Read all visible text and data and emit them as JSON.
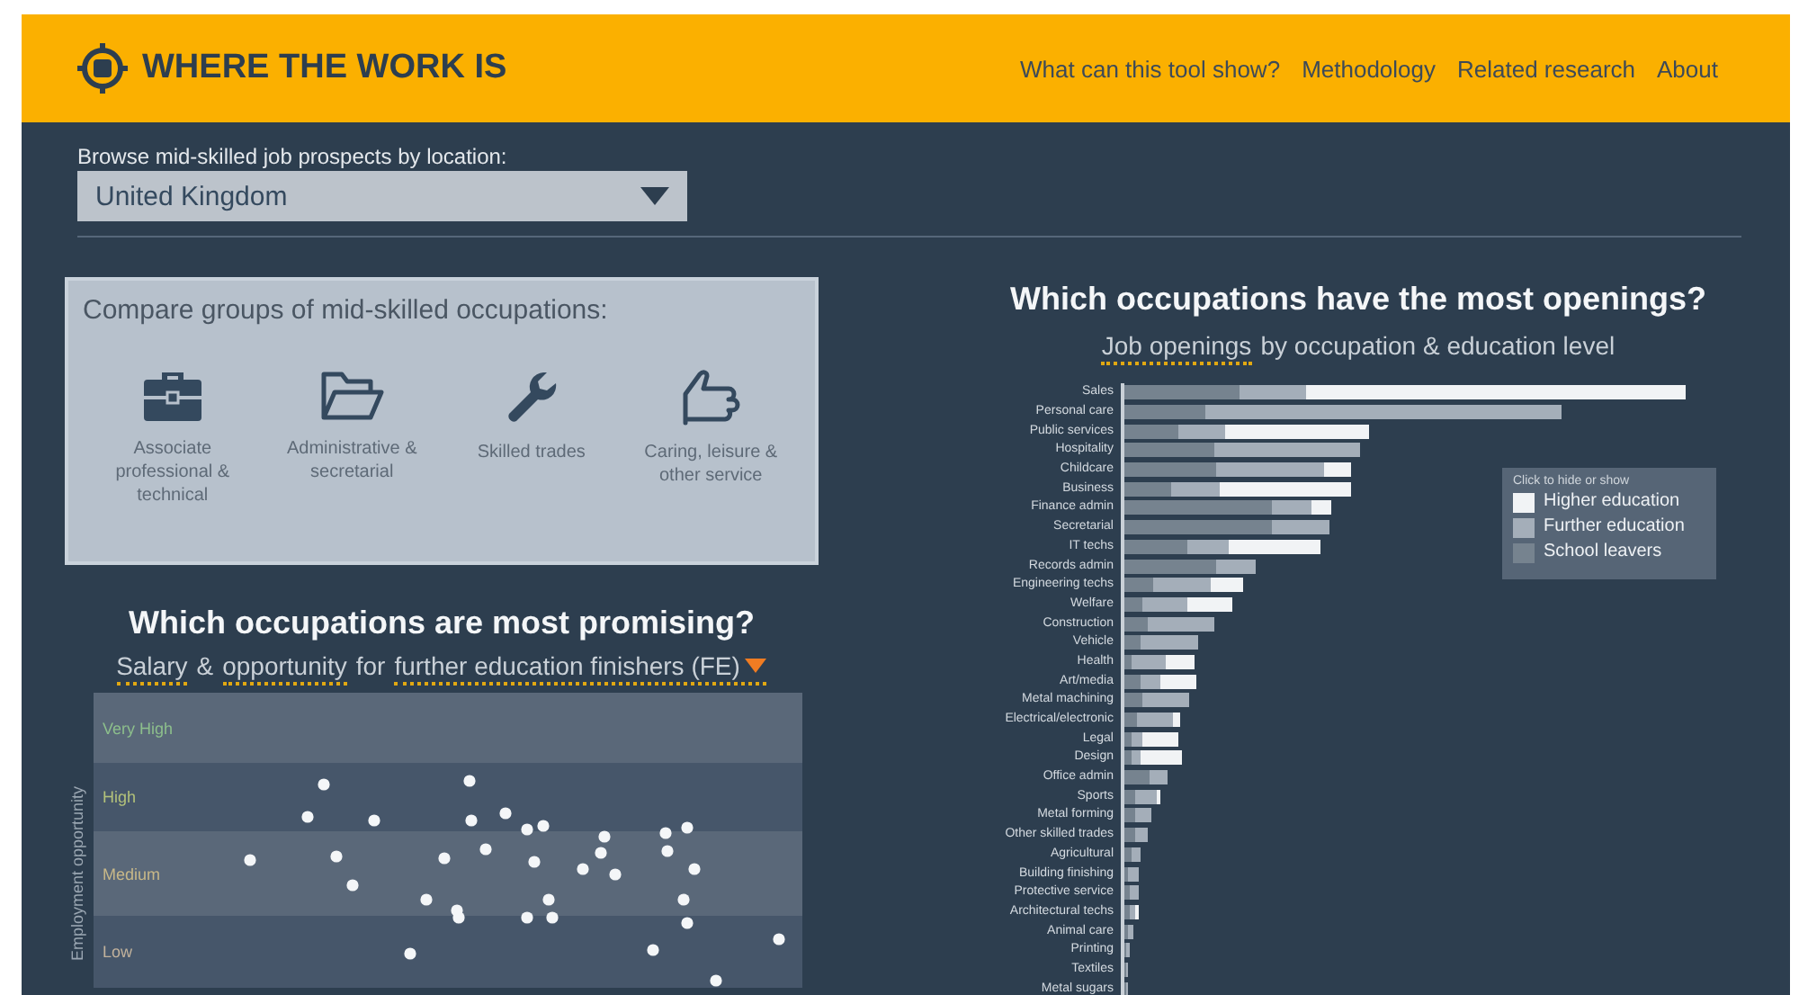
{
  "header": {
    "title": "WHERE THE WORK IS",
    "nav": [
      "What can this tool show?",
      "Methodology",
      "Related research",
      "About"
    ]
  },
  "location": {
    "label": "Browse mid-skilled job prospects by location:",
    "value": "United Kingdom"
  },
  "compare": {
    "title": "Compare groups of mid-skilled occupations:",
    "groups": [
      "Associate professional & technical",
      "Administrative & secretarial",
      "Skilled trades",
      "Caring, leisure & other service"
    ]
  },
  "promising": {
    "title": "Which occupations are most promising?",
    "subtitle": [
      {
        "text": "Salary",
        "selectable": true
      },
      {
        "text": "&",
        "selectable": false
      },
      {
        "text": "opportunity",
        "selectable": true
      },
      {
        "text": "for",
        "selectable": false
      },
      {
        "text": "further education finishers (FE)",
        "selectable": true
      }
    ],
    "y_label": "Employment opportunity",
    "bands": [
      {
        "label": "Very High",
        "color": "#8dbf8c"
      },
      {
        "label": "High",
        "color": "#b3c27a"
      },
      {
        "label": "Medium",
        "color": "#c8b888"
      },
      {
        "label": "Low",
        "color": "#c2b29c"
      }
    ]
  },
  "openings": {
    "title": "Which occupations have the most openings?",
    "subtitle": [
      {
        "text": "Job openings",
        "selectable": true
      },
      {
        "text": "by occupation & education level",
        "selectable": false
      }
    ],
    "categories": [
      "Sales",
      "Personal care",
      "Public services",
      "Hospitality",
      "Childcare",
      "Business",
      "Finance admin",
      "Secretarial",
      "IT techs",
      "Records admin",
      "Engineering techs",
      "Welfare",
      "Construction",
      "Vehicle",
      "Health",
      "Art/media",
      "Metal machining",
      "Electrical/electronic",
      "Legal",
      "Design",
      "Office admin",
      "Sports",
      "Metal forming",
      "Other skilled trades",
      "Agricultural",
      "Building finishing",
      "Protective service",
      "Architectural techs",
      "Animal care",
      "Printing",
      "Textiles",
      "Metal sugars"
    ],
    "legend": {
      "title": "Click to hide or show",
      "items": [
        {
          "label": "Higher education",
          "color": "#f1f3f5"
        },
        {
          "label": "Further education",
          "color": "#a4aeb9"
        },
        {
          "label": "School leavers",
          "color": "#76838f"
        }
      ]
    }
  }
}
